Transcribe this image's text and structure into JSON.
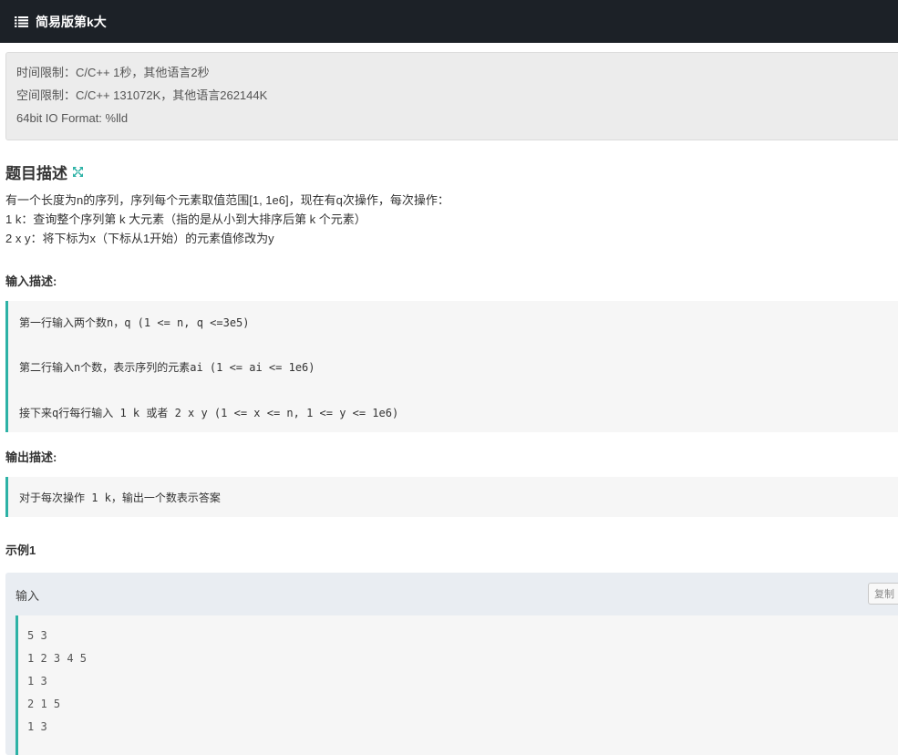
{
  "header": {
    "title": "简易版第k大"
  },
  "limits": {
    "time": "时间限制：C/C++ 1秒，其他语言2秒",
    "space": "空间限制：C/C++ 131072K，其他语言262144K",
    "io_format": "64bit IO Format: %lld"
  },
  "description": {
    "title": "题目描述",
    "lines": [
      "有一个长度为n的序列，序列每个元素取值范围[1, 1e6]，现在有q次操作，每次操作：",
      "1 k：查询整个序列第 k 大元素（指的是从小到大排序后第 k 个元素）",
      "2 x y：将下标为x（下标从1开始）的元素值修改为y"
    ]
  },
  "input_desc": {
    "title": "输入描述:",
    "lines": [
      "第一行输入两个数n，q (1 <= n, q <=3e5)",
      "第二行输入n个数，表示序列的元素ai (1 <= ai <= 1e6)",
      "接下来q行每行输入 1 k 或者 2 x y (1 <= x <= n, 1 <= y <= 1e6)"
    ]
  },
  "output_desc": {
    "title": "输出描述:",
    "lines": [
      "对于每次操作 1 k，输出一个数表示答案"
    ]
  },
  "example": {
    "title": "示例1",
    "input_label": "输入",
    "copy_label": "复制",
    "lines": [
      "5 3",
      "1 2 3 4 5",
      "1 3",
      "2 1 5",
      "1 3"
    ]
  }
}
